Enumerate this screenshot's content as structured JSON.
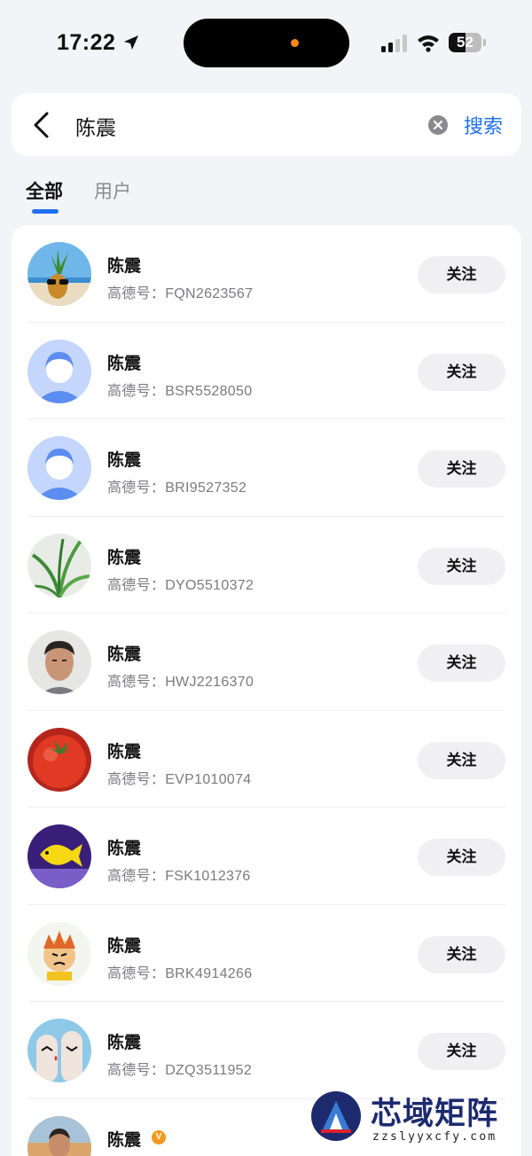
{
  "status_bar": {
    "time": "17:22",
    "battery_level": "52",
    "battery_fraction": 0.52,
    "icons": [
      "location-arrow-icon",
      "cellular-signal-icon",
      "wifi-icon",
      "battery-icon"
    ]
  },
  "search": {
    "query": "陈震",
    "submit_label": "搜索"
  },
  "tabs": [
    {
      "label": "全部",
      "active": true
    },
    {
      "label": "用户",
      "active": false
    }
  ],
  "follow_label": "关注",
  "users": [
    {
      "name": "陈震",
      "id_label": "高德号：",
      "id": "FQN2623567",
      "avatar": "pineapple-beach"
    },
    {
      "name": "陈震",
      "id_label": "高德号：",
      "id": "BSR5528050",
      "avatar": "default"
    },
    {
      "name": "陈震",
      "id_label": "高德号：",
      "id": "BRI9527352",
      "avatar": "default"
    },
    {
      "name": "陈震",
      "id_label": "高德号：",
      "id": "DYO5510372",
      "avatar": "plant"
    },
    {
      "name": "陈震",
      "id_label": "高德号：",
      "id": "HWJ2216370",
      "avatar": "portrait"
    },
    {
      "name": "陈震",
      "id_label": "高德号：",
      "id": "EVP1010074",
      "avatar": "tomato"
    },
    {
      "name": "陈震",
      "id_label": "高德号：",
      "id": "FSK1012376",
      "avatar": "fish"
    },
    {
      "name": "陈震",
      "id_label": "高德号：",
      "id": "BRK4914266",
      "avatar": "cartoon"
    },
    {
      "name": "陈震",
      "id_label": "高德号：",
      "id": "DZQ3511952",
      "avatar": "fingers"
    },
    {
      "name": "陈震",
      "id_label": "",
      "id": "",
      "avatar": "man-photo",
      "verified": true
    }
  ],
  "watermark": {
    "title": "芯域矩阵",
    "url": "zzslyyxcfy.com"
  },
  "colors": {
    "accent": "#1f6ff0",
    "background": "#f3f4f7",
    "button_bg": "#f0f0f3",
    "verified_badge": "#f29a1c"
  }
}
